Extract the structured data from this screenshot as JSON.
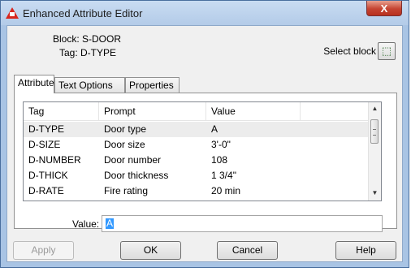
{
  "window": {
    "title": "Enhanced Attribute Editor",
    "close_label": "X"
  },
  "header": {
    "block": "Block: S-DOOR",
    "tag": "Tag: D-TYPE",
    "select_block_label": "Select block"
  },
  "tabs": [
    {
      "label": "Attribute"
    },
    {
      "label": "Text Options"
    },
    {
      "label": "Properties"
    }
  ],
  "grid": {
    "columns": [
      "Tag",
      "Prompt",
      "Value"
    ],
    "rows": [
      {
        "tag": "D-TYPE",
        "prompt": "Door type",
        "value": "A"
      },
      {
        "tag": "D-SIZE",
        "prompt": "Door size",
        "value": "3'-0\""
      },
      {
        "tag": "D-NUMBER",
        "prompt": "Door number",
        "value": "108"
      },
      {
        "tag": "D-THICK",
        "prompt": "Door thickness",
        "value": "1 3/4\""
      },
      {
        "tag": "D-RATE",
        "prompt": "Fire rating",
        "value": "20 min"
      }
    ],
    "selected_row": 0
  },
  "value_field": {
    "label": "Value:",
    "value": "A"
  },
  "buttons": {
    "apply": "Apply",
    "ok": "OK",
    "cancel": "Cancel",
    "help": "Help"
  }
}
